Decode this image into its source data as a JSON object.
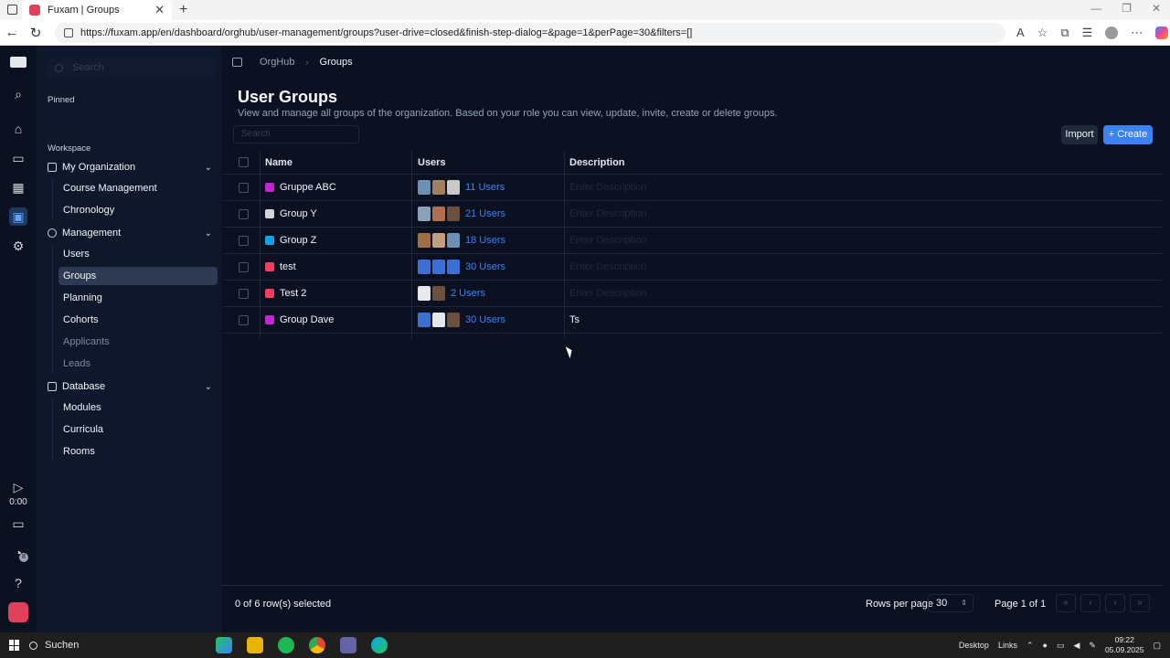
{
  "browser": {
    "tab_title": "Fuxam | Groups",
    "url": "https://fuxam.app/en/dashboard/orghub/user-management/groups?user-drive=closed&finish-step-dialog=&page=1&perPage=30&filters=[]"
  },
  "rail": {
    "timer": "0:00",
    "notification_count": "8"
  },
  "sidebar": {
    "search_placeholder": "Search",
    "pinned_label": "Pinned",
    "workspace_label": "Workspace",
    "groups": [
      {
        "label": "My Organization",
        "items": [
          {
            "label": "Course Management"
          },
          {
            "label": "Chronology"
          }
        ]
      },
      {
        "label": "Management",
        "items": [
          {
            "label": "Users"
          },
          {
            "label": "Groups",
            "active": true
          },
          {
            "label": "Planning"
          },
          {
            "label": "Cohorts"
          },
          {
            "label": "Applicants",
            "muted": true
          },
          {
            "label": "Leads",
            "muted": true
          }
        ]
      },
      {
        "label": "Database",
        "items": [
          {
            "label": "Modules"
          },
          {
            "label": "Curricula"
          },
          {
            "label": "Rooms"
          }
        ]
      }
    ]
  },
  "breadcrumb": {
    "parent": "OrgHub",
    "current": "Groups"
  },
  "page": {
    "title": "User Groups",
    "subtitle": "View and manage all groups of the organization. Based on your role you can view, update, invite, create or delete groups.",
    "search_placeholder": "Search",
    "import_label": "Import",
    "create_label": "Create"
  },
  "table": {
    "headers": {
      "name": "Name",
      "users": "Users",
      "description": "Description"
    },
    "description_placeholder": "Enter Description",
    "rows": [
      {
        "name": "Gruppe ABC",
        "color": "#c026d3",
        "users": "11 Users",
        "description": "",
        "avatars": [
          "#6b8fb5",
          "#a08060",
          "#c9c9c9"
        ]
      },
      {
        "name": "Group Y",
        "color": "#d1d5db",
        "users": "21 Users",
        "description": "",
        "avatars": [
          "#8aa0b8",
          "#b07050",
          "#6b5040"
        ]
      },
      {
        "name": "Group Z",
        "color": "#0ea5e9",
        "users": "18 Users",
        "description": "",
        "avatars": [
          "#a07040",
          "#c0a080",
          "#6b8fb5"
        ]
      },
      {
        "name": "test",
        "color": "#f43f5e",
        "users": "30 Users",
        "description": "",
        "avatars": [
          "#3b6fd0",
          "#3b6fd0",
          "#3b6fd0"
        ]
      },
      {
        "name": "Test 2",
        "color": "#f43f5e",
        "users": "2 Users",
        "description": "",
        "avatars": [
          "#e5e7eb",
          "#6b5040"
        ]
      },
      {
        "name": "Group Dave",
        "color": "#c026d3",
        "users": "30 Users",
        "description": "Ts",
        "avatars": [
          "#3b6fd0",
          "#e5e7eb",
          "#6b5040"
        ]
      }
    ]
  },
  "footer": {
    "selection_text": "0 of 6 row(s) selected",
    "rows_per_page_label": "Rows per page",
    "rows_per_page_value": "30",
    "page_text": "Page 1 of 1"
  },
  "taskbar": {
    "search_label": "Suchen",
    "desktop_label": "Desktop",
    "links_label": "Links",
    "time": "09:22",
    "date": "05.09.2025"
  }
}
